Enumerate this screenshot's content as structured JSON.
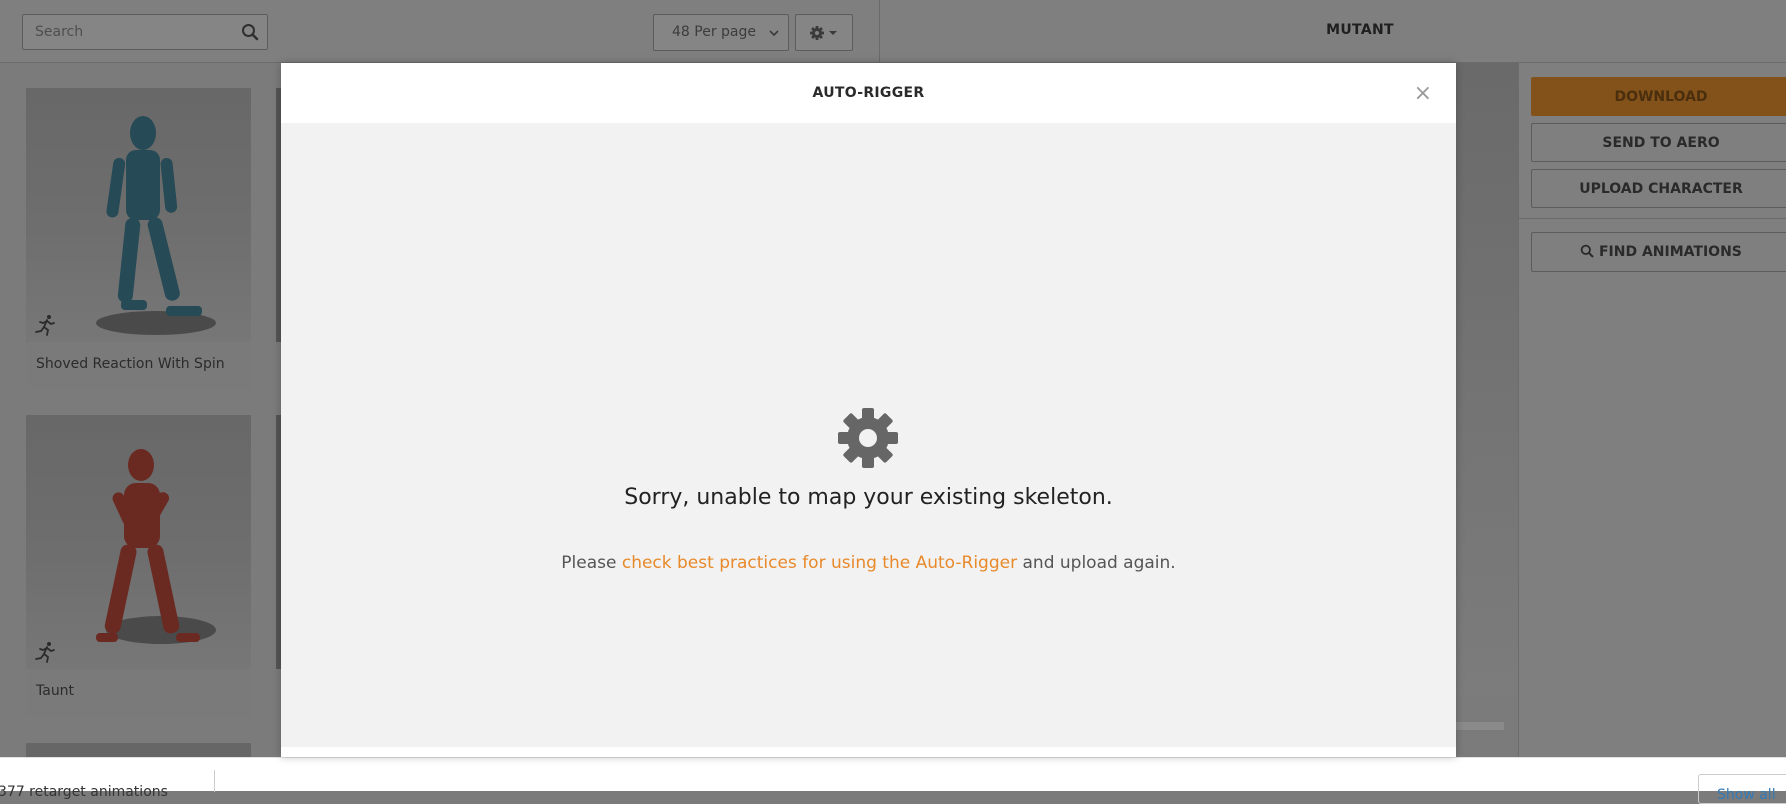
{
  "topbar": {
    "search_placeholder": "Search",
    "per_page": "48 Per page",
    "character_title": "MUTANT"
  },
  "grid": {
    "cards": [
      {
        "label": "Shoved Reaction With Spin"
      },
      {
        "label": "Taunt"
      }
    ]
  },
  "sidebar": {
    "download": "DOWNLOAD",
    "send_to_aero": "SEND TO AERO",
    "upload_character": "UPLOAD CHARACTER",
    "find_animations": "FIND ANIMATIONS"
  },
  "modal": {
    "title": "AUTO-RIGGER",
    "close": "×",
    "error_title": "Sorry, unable to map your existing skeleton.",
    "message_prefix": "Please ",
    "message_link": "check best practices for using the Auto-Rigger",
    "message_suffix": " and upload again."
  },
  "bottombar": {
    "text": "377 retarget animations",
    "show_all": "Show all"
  },
  "colors": {
    "accent": "#e8892a",
    "modal_body": "#f2f2f2",
    "overlay": "#7b7b7b"
  }
}
